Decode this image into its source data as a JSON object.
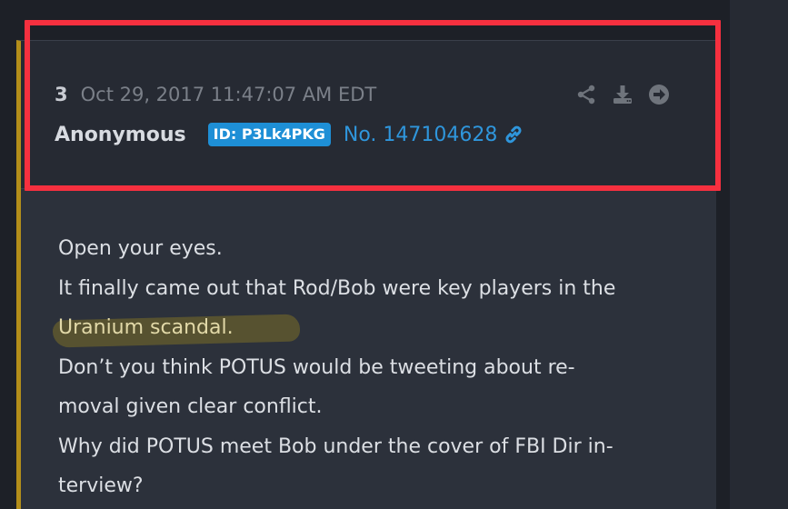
{
  "post": {
    "number": "3",
    "date": "Oct 29, 2017 11:47:07 AM EDT",
    "author": "Anonymous",
    "id_badge": "ID: P3Lk4PKG",
    "post_no": "No. 147104628",
    "actions": [
      "share-icon",
      "download-icon",
      "arrow-right-circle-icon"
    ],
    "body_lines": [
      "Open your eyes.",
      "It finally came out that Rod/Bob were key players in the",
      "Uranium scandal.",
      "Don’t you think POTUS would be tweeting about re-",
      "moval given clear conflict.",
      "Why did POTUS meet Bob under the cover of FBI Dir in-",
      "terview?"
    ]
  },
  "colors": {
    "background": "#1d2027",
    "header_bg": "#262a33",
    "post_bg": "#2c313b",
    "accent_left_border": "#b38e1a",
    "highlight_box": "#f6303f",
    "badge_bg": "#1e8fd6",
    "link": "#2f96dc"
  }
}
